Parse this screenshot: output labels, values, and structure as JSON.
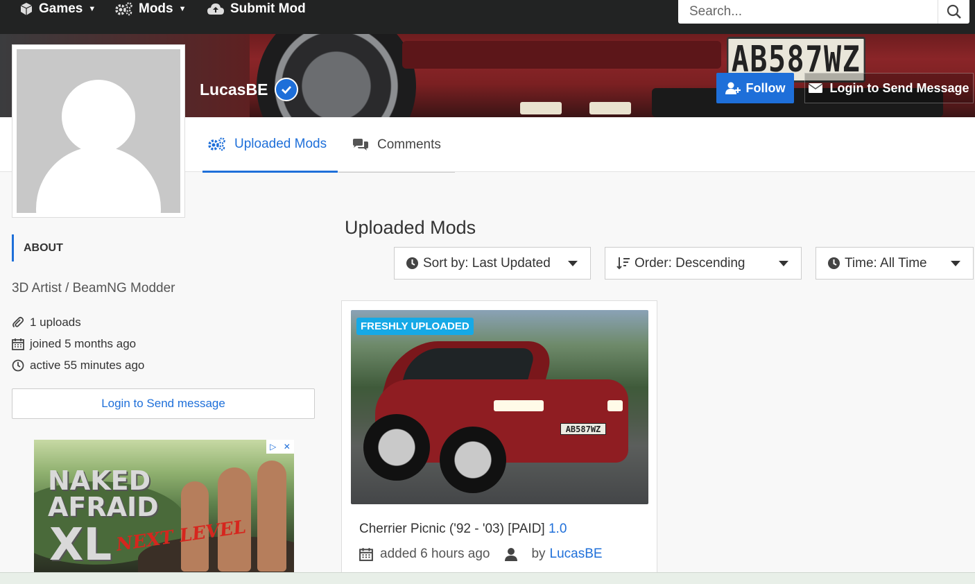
{
  "nav": {
    "games_label": "Games",
    "mods_label": "Mods",
    "submit_label": "Submit Mod",
    "search_placeholder": "Search..."
  },
  "banner": {
    "plate_text": "AB587WZ"
  },
  "profile": {
    "username": "LucasBE",
    "follow_label": "Follow",
    "send_message_label": "Login to Send Message"
  },
  "tabs": [
    {
      "label": "Uploaded Mods",
      "active": true
    },
    {
      "label": "Comments",
      "active": false
    }
  ],
  "sidebar": {
    "about_heading": "ABOUT",
    "bio": "3D Artist / BeamNG Modder",
    "stats": {
      "uploads": "1 uploads",
      "joined": "joined 5 months ago",
      "active": "active 55 minutes ago"
    },
    "login_message_label": "Login to Send message"
  },
  "ad": {
    "line1": "NAKED",
    "line1b": "AFRAID",
    "line2": "XL",
    "next_level": "NEXT LEVEL"
  },
  "main": {
    "title": "Uploaded Mods",
    "sort": "Sort by: Last Updated",
    "order": "Order: Descending",
    "time": "Time: All Time"
  },
  "mods": [
    {
      "badge": "FRESHLY UPLOADED",
      "title": "Cherrier Picnic ('92 - '03) [PAID]",
      "version": "1.0",
      "added": "added 6 hours ago",
      "by_label": "by",
      "author": "LucasBE",
      "plate": "AB587WZ"
    }
  ],
  "colors": {
    "accent": "#1e6fd9",
    "badge": "#16a9e6",
    "nav_bg": "#222323"
  }
}
